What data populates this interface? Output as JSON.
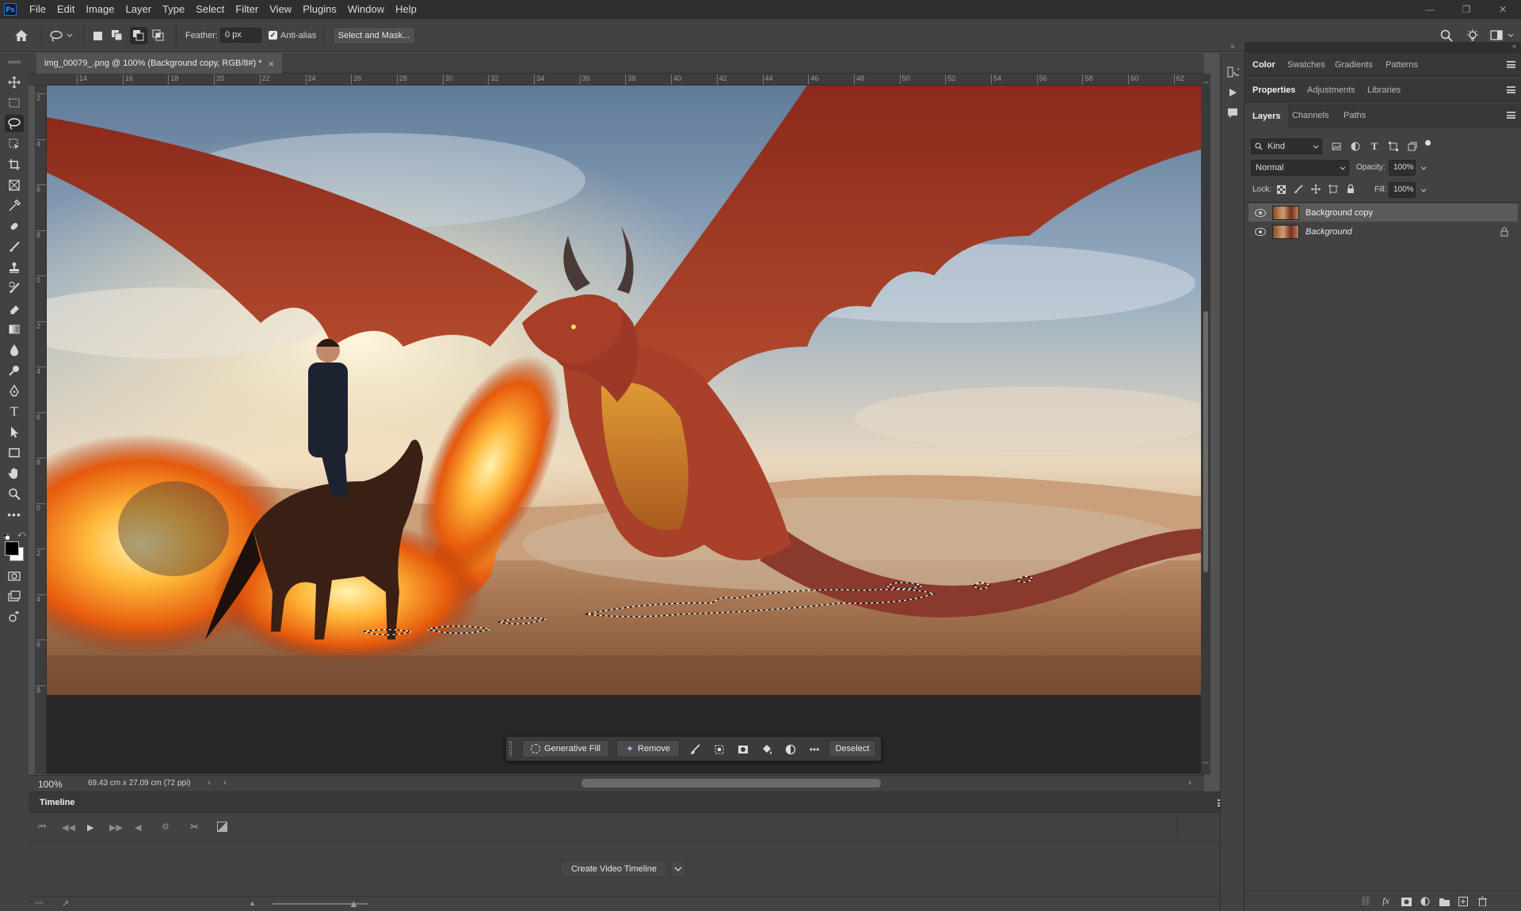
{
  "app": {
    "logo": "Ps"
  },
  "menu": [
    "File",
    "Edit",
    "Image",
    "Layer",
    "Type",
    "Select",
    "Filter",
    "View",
    "Plugins",
    "Window",
    "Help"
  ],
  "window_controls": {
    "minimize": "—",
    "restore": "❐",
    "close": "✕"
  },
  "options_bar": {
    "feather_label": "Feather:",
    "feather_value": "0 px",
    "antialias_label": "Anti-alias",
    "antialias_checked": true,
    "select_mask_label": "Select and Mask..."
  },
  "document": {
    "tab_title": "img_00079_.png @ 100% (Background copy, RGB/8#) *",
    "close": "×",
    "ruler_top": [
      "14",
      "16",
      "18",
      "20",
      "22",
      "24",
      "26",
      "28",
      "30",
      "32",
      "34",
      "36",
      "38",
      "40",
      "42",
      "44",
      "46",
      "48",
      "50",
      "52",
      "54",
      "56",
      "58",
      "60",
      "62"
    ],
    "ruler_left": [
      "2",
      "4",
      "6",
      "8",
      "0",
      "2",
      "4",
      "6",
      "8",
      "0",
      "2",
      "4",
      "6",
      "8"
    ],
    "zoom": "100%",
    "doc_info": "69.43 cm x 27.09 cm (72 ppi)"
  },
  "context_bar": {
    "generative_fill": "Generative Fill",
    "remove": "Remove",
    "deselect": "Deselect"
  },
  "timeline": {
    "title": "Timeline",
    "create_label": "Create Video Timeline"
  },
  "panels": {
    "group1": {
      "tabs": [
        "Color",
        "Swatches",
        "Gradients",
        "Patterns"
      ],
      "selected": "Color"
    },
    "group2": {
      "tabs": [
        "Properties",
        "Adjustments",
        "Libraries"
      ],
      "selected": "Properties"
    },
    "group3": {
      "tabs": [
        "Layers",
        "Channels",
        "Paths"
      ],
      "selected": "Layers"
    },
    "layers": {
      "filter_kind": "Kind",
      "blend_mode": "Normal",
      "opacity_label": "Opacity:",
      "opacity_value": "100%",
      "lock_label": "Lock:",
      "fill_label": "Fill:",
      "fill_value": "100%",
      "items": [
        {
          "name": "Background copy",
          "selected": true,
          "locked": false
        },
        {
          "name": "Background",
          "selected": false,
          "locked": true
        }
      ]
    }
  },
  "colors": {
    "accent": "#31a8ff",
    "selected_layer": "#5a5a5a"
  }
}
